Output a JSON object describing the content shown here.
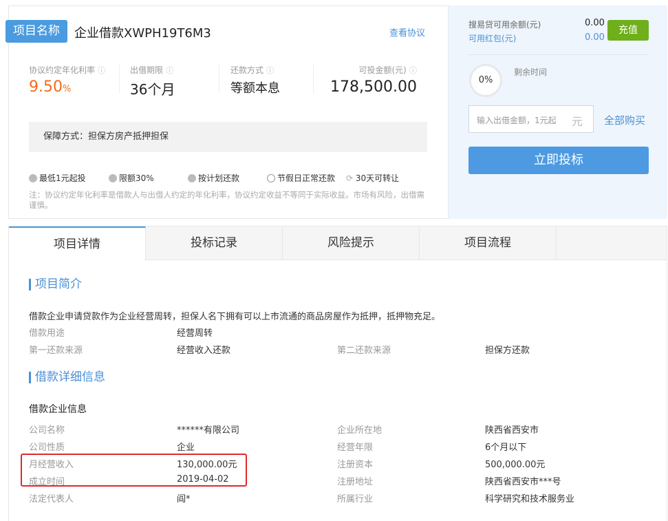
{
  "header": {
    "badge": "项目名称",
    "title": "企业借款XWPH19T6M3",
    "agreement_link": "查看协议"
  },
  "stats": [
    {
      "label": "协议约定年化利率",
      "value": "9.50",
      "unit": "%"
    },
    {
      "label": "出借期限",
      "value": "36个月"
    },
    {
      "label": "还款方式",
      "value": "等额本息"
    },
    {
      "label": "可投金额(元)",
      "value": "178,500.00"
    }
  ],
  "guarantee": "保障方式：担保方房产抵押担保",
  "features": [
    "最低1元起投",
    "限额30%",
    "按计划还款",
    "节假日正常还款",
    "30天可转让"
  ],
  "note": "注：协议约定年化利率是借款人与出借人约定的年化利率，协议约定收益不等同于实际收益。市场有风险，出借需谨慎。",
  "account": {
    "balance_label": "搜易贷可用余额(元)",
    "balance": "0.00",
    "coupon_label": "可用红包(元)",
    "coupon": "0.00",
    "recharge": "充值",
    "progress": "0%",
    "progress_value": 0,
    "remaining_label": "剩余时间",
    "input_placeholder": "输入出借金额，1元起",
    "input_unit": "元",
    "buy_all": "全部购买",
    "invest": "立即投标"
  },
  "tabs": [
    "项目详情",
    "投标记录",
    "风险提示",
    "项目流程"
  ],
  "intro": {
    "heading": "项目简介",
    "text": "借款企业申请贷款作为企业经营周转，担保人名下拥有可以上市流通的商品房屋作为抵押，抵押物充足。",
    "rows": [
      [
        "借款用途",
        "经营周转",
        "",
        ""
      ],
      [
        "第一还款来源",
        "经营收入还款",
        "第二还款来源",
        "担保方还款"
      ]
    ]
  },
  "detail": {
    "heading": "借款详细信息",
    "subheading": "借款企业信息",
    "rows": [
      [
        "公司名称",
        "******有限公司",
        "企业所在地",
        "陕西省西安市"
      ],
      [
        "公司性质",
        "企业",
        "经营年限",
        "6个月以下"
      ],
      [
        "月经营收入",
        "130,000.00元",
        "注册资本",
        "500,000.00元"
      ],
      [
        "成立时间",
        "2019-04-02",
        "注册地址",
        "陕西省西安市***号"
      ],
      [
        "法定代表人",
        "阎*",
        "所属行业",
        "科学研究和技术服务业"
      ]
    ]
  }
}
